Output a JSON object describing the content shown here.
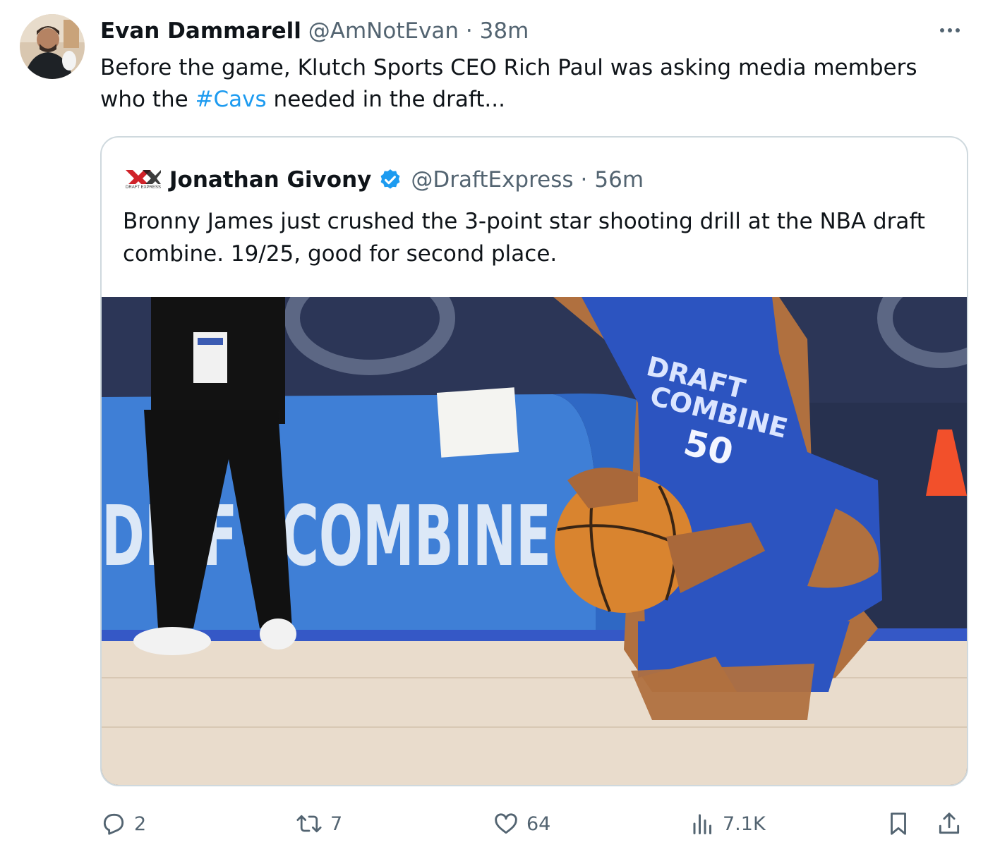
{
  "tweet": {
    "author_name": "Evan Dammarell",
    "author_handle": "@AmNotEvan",
    "separator": "·",
    "time": "38m",
    "more_icon": "more-horizontal-icon",
    "text_before": "Before the game, Klutch Sports CEO Rich Paul was asking media members who the ",
    "hashtag": "#Cavs",
    "text_after": " needed in the draft..."
  },
  "quoted": {
    "logo_text": "DRAFT EXPRESS",
    "author_name": "Jonathan Givony",
    "verified_icon": "verified-badge-icon",
    "author_handle": "@DraftExpress",
    "separator": "·",
    "time": "56m",
    "text": "Bronny James just crushed the 3-point star shooting drill at the NBA draft combine. 19/25, good for second place.",
    "photo": {
      "banner_text": "DRAFT COMBINE",
      "banner_partial": "DR  F",
      "banner_main": "COMBINE",
      "jersey_lines": [
        "DRAFT",
        "COMBINE"
      ],
      "jersey_number": "50"
    }
  },
  "actions": {
    "reply_count": "2",
    "retweet_count": "7",
    "like_count": "64",
    "views_count": "7.1K"
  },
  "colors": {
    "link": "#1d9bf0",
    "muted": "#536471",
    "text": "#0f1419",
    "border": "#cfd9de",
    "verified": "#1d9bf0"
  }
}
